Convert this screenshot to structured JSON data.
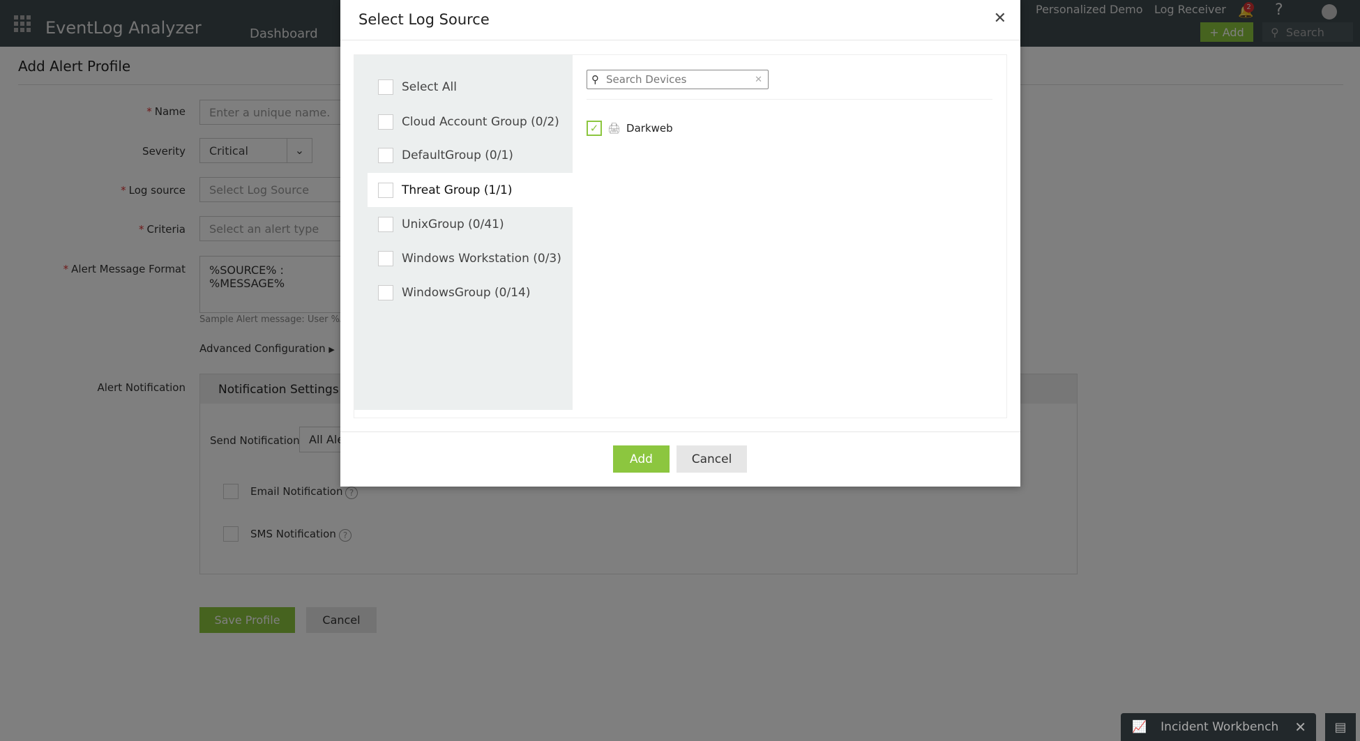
{
  "app": {
    "name": "EventLog Analyzer",
    "nav_tab": "Dashboard",
    "personalized_demo": "Personalized Demo",
    "log_receiver": "Log Receiver",
    "notification_count": "2",
    "help": "?",
    "add_label": "Add",
    "search_placeholder": "Search"
  },
  "page": {
    "title": "Add Alert Profile",
    "fields": {
      "name_label": "Name",
      "name_placeholder": "Enter a unique name.",
      "severity_label": "Severity",
      "severity_value": "Critical",
      "log_source_label": "Log source",
      "log_source_placeholder": "Select Log Source",
      "criteria_label": "Criteria",
      "criteria_placeholder": "Select an alert type",
      "message_label": "Alert Message Format",
      "message_value": "%SOURCE% : %MESSAGE%",
      "sample": "Sample Alert message: User %AC",
      "advanced": "Advanced Configuration"
    },
    "notification": {
      "label": "Alert Notification",
      "settings_title": "Notification Settings",
      "send_label": "Send Notification",
      "send_value": "All Ale",
      "email": "Email Notification",
      "sms": "SMS Notification"
    },
    "save": "Save Profile",
    "cancel": "Cancel"
  },
  "modal": {
    "title": "Select Log Source",
    "groups": [
      {
        "label": "Select All"
      },
      {
        "label": "Cloud Account Group (0/2)"
      },
      {
        "label": "DefaultGroup (0/1)"
      },
      {
        "label": "Threat Group (1/1)",
        "selected": true
      },
      {
        "label": "UnixGroup (0/41)"
      },
      {
        "label": "Windows Workstation (0/3)"
      },
      {
        "label": "WindowsGroup (0/14)"
      }
    ],
    "search_placeholder": "Search Devices",
    "devices": [
      {
        "label": "Darkweb",
        "checked": true
      }
    ],
    "add": "Add",
    "cancel": "Cancel"
  },
  "footer": {
    "incident_workbench": "Incident Workbench"
  },
  "colors": {
    "accent": "#8cc63f",
    "navbar": "#3f4a4f"
  }
}
